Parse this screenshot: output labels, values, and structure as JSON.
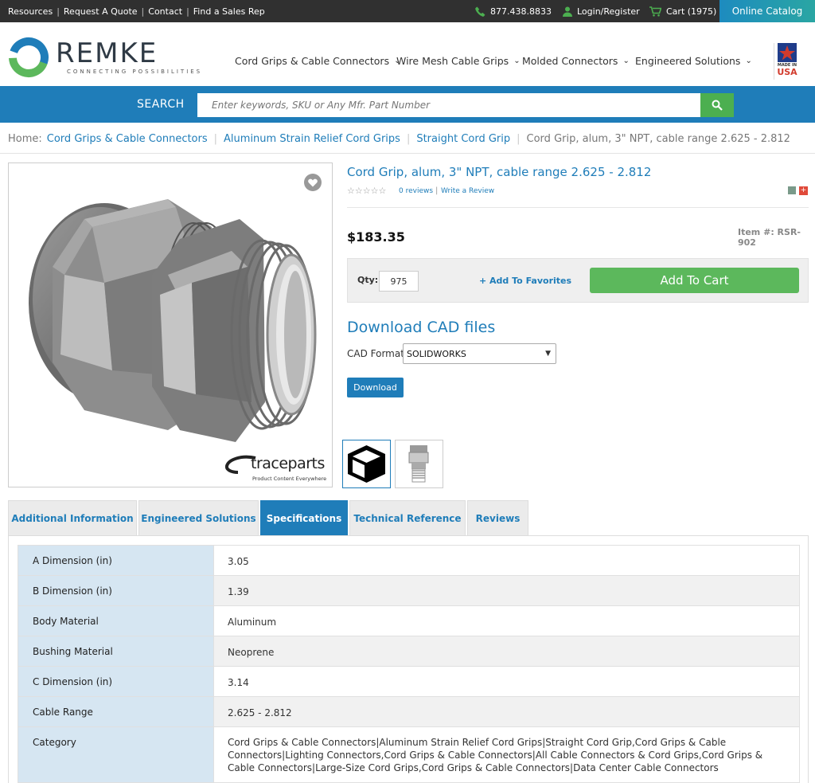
{
  "topbar": {
    "links": [
      "Resources",
      "Request A Quote",
      "Contact",
      "Find a Sales Rep"
    ],
    "phone": "877.438.8833",
    "login": "Login/Register",
    "cart": "Cart (1975)",
    "online_catalog": "Online Catalog"
  },
  "brand": {
    "name": "REMKE",
    "tagline": "CONNECTING POSSIBILITIES",
    "usa_badge": [
      "MADE IN",
      "USA"
    ]
  },
  "nav": [
    "Cord Grips & Cable Connectors",
    "Wire Mesh Cable Grips",
    "Molded Connectors",
    "Engineered Solutions"
  ],
  "search": {
    "label": "SEARCH",
    "placeholder": "Enter keywords, SKU or Any Mfr. Part Number"
  },
  "breadcrumb": {
    "home": "Home:",
    "links": [
      "Cord Grips & Cable Connectors",
      "Aluminum Strain Relief Cord Grips",
      "Straight Cord Grip"
    ],
    "current": "Cord Grip, alum, 3\" NPT, cable range 2.625 - 2.812"
  },
  "product": {
    "title": "Cord Grip, alum, 3\" NPT, cable range 2.625 - 2.812",
    "rating_stars": "☆☆☆☆☆",
    "rating": 0,
    "reviews_link": "0 reviews",
    "write_review": "Write a Review",
    "price": "$183.35",
    "item_number": "Item #: RSR-902",
    "qty_label": "Qty:",
    "qty_value": "975",
    "add_favorites": "+ Add To Favorites",
    "add_to_cart": "Add To Cart",
    "watermark": "traceparts",
    "watermark_sub": "Product Content Everywhere"
  },
  "cad": {
    "title": "Download CAD files",
    "format_label": "CAD Format:",
    "format_value": "SOLIDWORKS",
    "download": "Download"
  },
  "tabs": [
    {
      "label": "Additional Information",
      "active": false
    },
    {
      "label": "Engineered Solutions",
      "active": false
    },
    {
      "label": "Specifications",
      "active": true
    },
    {
      "label": "Technical Reference",
      "active": false
    },
    {
      "label": "Reviews",
      "active": false
    }
  ],
  "specs": [
    {
      "key": "A Dimension (in)",
      "value": "3.05"
    },
    {
      "key": "B Dimension (in)",
      "value": "1.39"
    },
    {
      "key": "Body Material",
      "value": "Aluminum"
    },
    {
      "key": "Bushing Material",
      "value": "Neoprene"
    },
    {
      "key": "C Dimension (in)",
      "value": "3.14"
    },
    {
      "key": "Cable Range",
      "value": "2.625 - 2.812"
    },
    {
      "key": "Category",
      "value": "Cord Grips & Cable Connectors|Aluminum Strain Relief Cord Grips|Straight Cord Grip,Cord Grips & Cable Connectors|Lighting Connectors,Cord Grips & Cable Connectors|All Cable Connectors & Cord Grips,Cord Grips & Cable Connectors|Large-Size Cord Grips,Cord Grips & Cable Connectors|Data Center Cable Connectors"
    }
  ],
  "colors": {
    "brand_blue": "#1f7db9",
    "cart_green": "#5cb85c",
    "search_green": "#4caf50",
    "topbar": "#303030"
  }
}
